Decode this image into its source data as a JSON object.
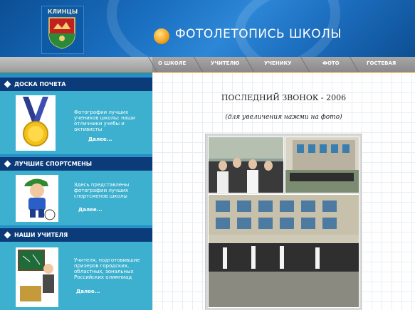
{
  "header": {
    "crest_title": "КЛИНЦЫ",
    "site_title": "ФОТОЛЕТОПИСЬ ШКОЛЫ",
    "logo_icon": "orange-sphere-icon",
    "crest_icon": "city-coat-of-arms-icon"
  },
  "nav": {
    "items": [
      {
        "label": "О ШКОЛЕ"
      },
      {
        "label": "УЧИТЕЛЮ"
      },
      {
        "label": "УЧЕНИКУ"
      },
      {
        "label": "ФОТО"
      },
      {
        "label": "ГОСТЕВАЯ"
      }
    ]
  },
  "sidebar": {
    "sections": [
      {
        "title": "ДОСКА ПОЧЕТА",
        "text": "Фотографии лучших учеников школы: наши отличники учебы и активисты",
        "more": "Далее...",
        "icon": "gold-medal-icon"
      },
      {
        "title": "ЛУЧШИЕ СПОРТСМЕНЫ",
        "text": "Здесь представлены фотографии лучших спортсменов школы",
        "more": "Далее...",
        "icon": "athlete-boy-icon"
      },
      {
        "title": "НАШИ УЧИТЕЛЯ",
        "text": "Учителя, подготовившие призеров городских, областных, зональных Российских олимпиад",
        "more": "Далее...",
        "icon": "teacher-at-blackboard-icon"
      }
    ]
  },
  "main": {
    "title": "ПОСЛЕДНИЙ ЗВОНОК - 2006",
    "subtitle": "(для увеличения нажми на фото)"
  },
  "colors": {
    "header_blue": "#1a6fc0",
    "nav_gray": "#9b9b9b",
    "nav_accent": "#e8891b",
    "sidebar_head": "#0b3b78",
    "sidebar_body": "#3db0cf",
    "text_white": "#ffffff"
  }
}
